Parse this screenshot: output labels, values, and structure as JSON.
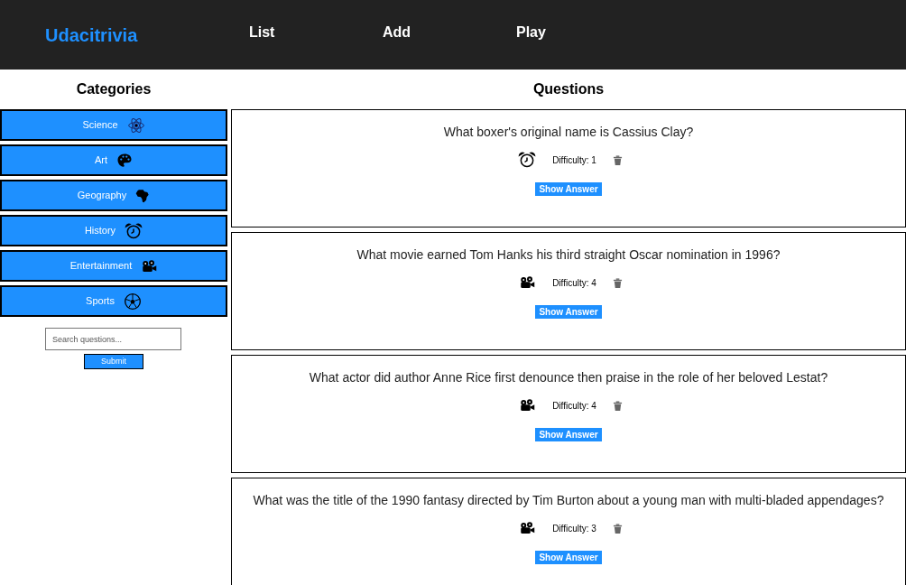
{
  "header": {
    "logo": "Udacitrivia",
    "nav": [
      {
        "label": "List"
      },
      {
        "label": "Add"
      },
      {
        "label": "Play"
      }
    ]
  },
  "categories": {
    "title": "Categories",
    "items": [
      {
        "label": "Science",
        "kind": "science"
      },
      {
        "label": "Art",
        "kind": "art"
      },
      {
        "label": "Geography",
        "kind": "geography"
      },
      {
        "label": "History",
        "kind": "history"
      },
      {
        "label": "Entertainment",
        "kind": "entertainment"
      },
      {
        "label": "Sports",
        "kind": "sports"
      }
    ],
    "search": {
      "placeholder": "Search questions..."
    },
    "submit": "Submit"
  },
  "questions": {
    "title": "Questions",
    "items": [
      {
        "question": "What boxer's original name is Cassius Clay?",
        "kind": "history",
        "difficulty": "Difficulty: 1",
        "button": "Show Answer"
      },
      {
        "question": "What movie earned Tom Hanks his third straight Oscar nomination in 1996?",
        "kind": "entertainment",
        "difficulty": "Difficulty: 4",
        "button": "Show Answer"
      },
      {
        "question": "What actor did author Anne Rice first denounce then praise in the role of her beloved Lestat?",
        "kind": "entertainment",
        "difficulty": "Difficulty: 4",
        "button": "Show Answer"
      },
      {
        "question": "What was the title of the 1990 fantasy directed by Tim Burton about a young man with multi-bladed appendages?",
        "kind": "entertainment",
        "difficulty": "Difficulty: 3",
        "button": "Show Answer"
      }
    ]
  }
}
